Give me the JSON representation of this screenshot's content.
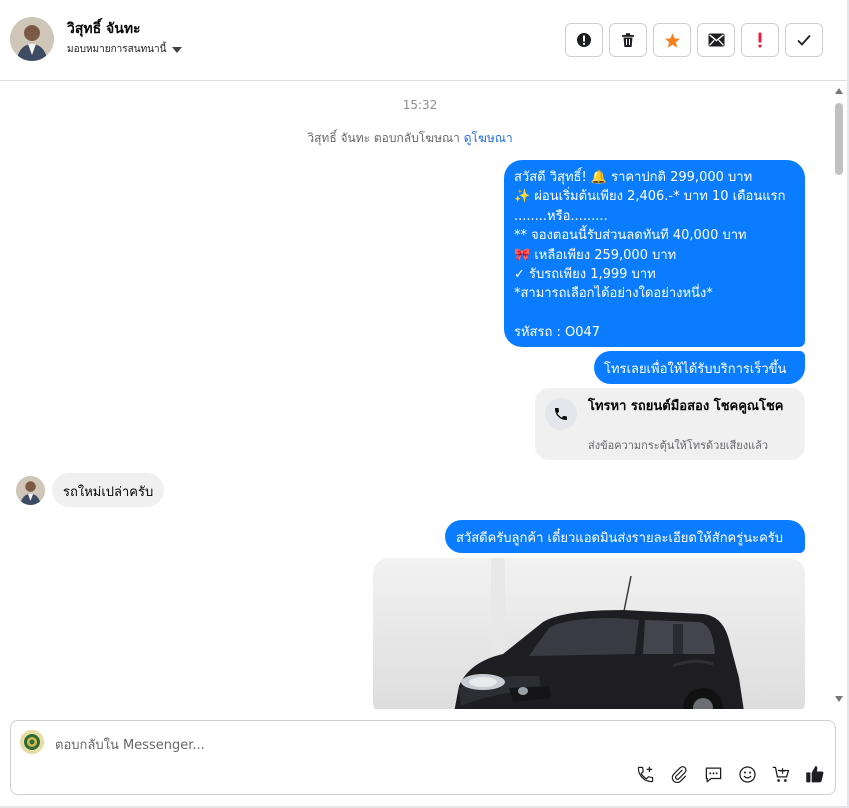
{
  "header": {
    "contact_name": "วิสุทธิ์ จันทะ",
    "assign_label": "มอบหมายการสนทนานี้",
    "actions": [
      "spam-icon",
      "trash-icon",
      "star-icon",
      "mail-icon",
      "exclamation-icon",
      "check-icon"
    ],
    "colors": {
      "star": "#f5821f",
      "important": "#e41e3f"
    }
  },
  "chat": {
    "timestamp": "15:32",
    "ad_reply_text": "วิสุทธิ์ จันทะ ตอบกลับโฆษณา",
    "ad_link": "ดูโฆษณา",
    "messages": {
      "offer": "สวัสดี วิสุทธิ์! 🔔  ราคาปกติ  299,000 บาท\n✨  ผ่อนเริ่มต้นเพียง 2,406.-* บาท 10 เดือนแรก\n........หรือ.........\n** จองตอนนี้รับส่วนลดทันที 40,000 บาท\n🎀  เหลือเพียง 259,000 บาท\n✓ รับรถเพียง 1,999 บาท\n*สามารถเลือกได้อย่างใดอย่างหนึ่ง*\n\n รหัสรถ : O047",
      "call_prompt": "โทรเลยเพื่อให้ได้รับบริการเร็วขึ้น",
      "call_card_title": "โทรหา รถยนต์มือสอง โชคคูณโชค",
      "call_card_sub": "ส่งข้อความกระตุ้นให้โทรด้วยเสียงแล้ว",
      "customer": "รถใหม่เปล่าครับ",
      "admin_reply": "สวัสดีครับลูกค้า เดี๋ยวแอดมินส่งรายละเอียดให้สักครู่นะครับ"
    },
    "colors": {
      "outgoing": "#0a7cff",
      "incoming": "#f0f0f0"
    }
  },
  "composer": {
    "placeholder": "ตอบกลับใน Messenger...",
    "tools": [
      "call-add-icon",
      "attach-icon",
      "saved-replies-icon",
      "emoji-icon",
      "cart-icon",
      "like-icon"
    ]
  }
}
